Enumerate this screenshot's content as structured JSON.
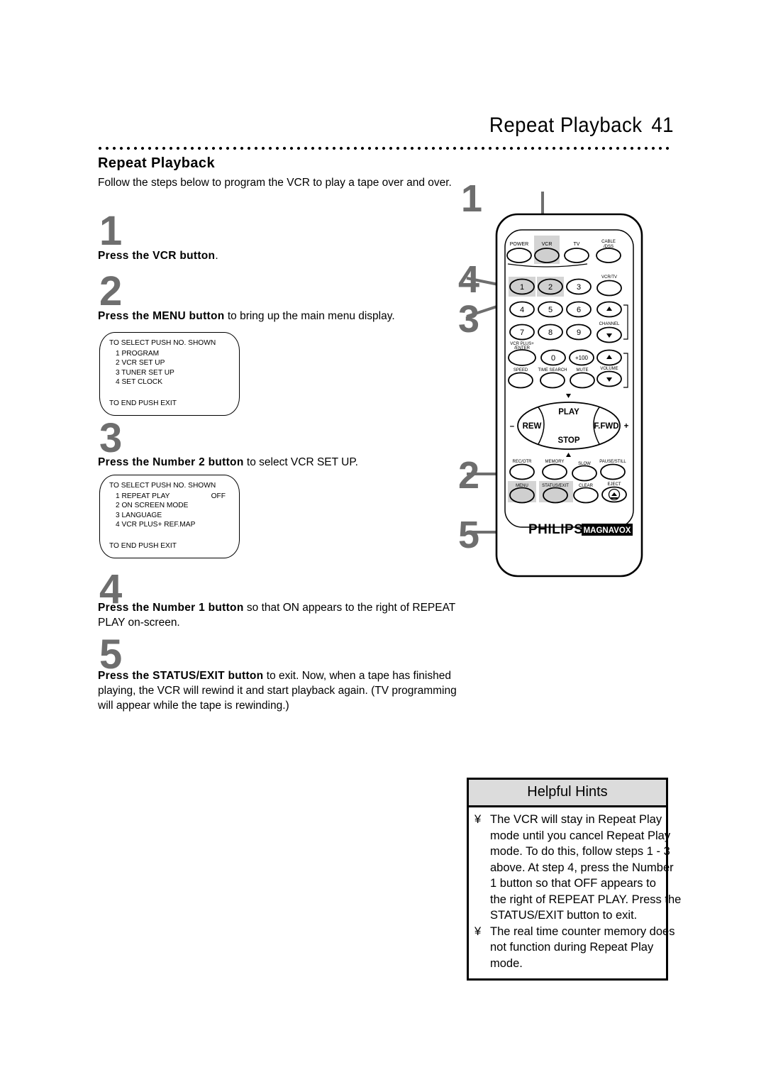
{
  "header": {
    "title": "Repeat Playback",
    "page_number": "41"
  },
  "section": {
    "title": "Repeat Playback",
    "intro": "Follow the steps below to program the VCR to play a tape over and over."
  },
  "steps": [
    {
      "number": "1",
      "bold": "Press the VCR button",
      "rest": "."
    },
    {
      "number": "2",
      "bold": "Press the MENU button",
      "rest": " to bring up the main menu display."
    },
    {
      "number": "3",
      "bold": "Press the Number 2 button",
      "rest": " to select VCR SET UP."
    },
    {
      "number": "4",
      "bold": "Press the Number 1 button",
      "rest": " so that ON appears to the right of REPEAT PLAY on-screen."
    },
    {
      "number": "5",
      "bold": "Press the STATUS/EXIT button",
      "rest": " to exit. Now, when a tape has finished playing, the VCR will rewind it and start playback again. (TV programming will appear while the tape is rewinding.)"
    }
  ],
  "osd_main_menu": {
    "head": "TO SELECT PUSH NO. SHOWN",
    "items": [
      {
        "label": "1 PROGRAM",
        "value": ""
      },
      {
        "label": "2 VCR SET UP",
        "value": ""
      },
      {
        "label": "3 TUNER SET UP",
        "value": ""
      },
      {
        "label": "4 SET CLOCK",
        "value": ""
      }
    ],
    "foot": "TO END PUSH EXIT"
  },
  "osd_vcr_setup": {
    "head": "TO SELECT PUSH NO. SHOWN",
    "items": [
      {
        "label": "1 REPEAT PLAY",
        "value": "OFF"
      },
      {
        "label": "2 ON SCREEN MODE",
        "value": ""
      },
      {
        "label": "3 LANGUAGE",
        "value": ""
      },
      {
        "label": "4 VCR PLUS+ REF.MAP",
        "value": ""
      }
    ],
    "foot": "TO END PUSH EXIT"
  },
  "remote": {
    "brand_primary": "PHILIPS",
    "brand_secondary": "MAGNAVOX",
    "callouts": [
      {
        "id": "1",
        "target": "VCR button"
      },
      {
        "id": "2",
        "target": "MENU button"
      },
      {
        "id": "3",
        "target": "Number 2 button"
      },
      {
        "id": "4",
        "target": "Number 1 button"
      },
      {
        "id": "5",
        "target": "STATUS/EXIT button"
      }
    ],
    "row_power": [
      "POWER",
      "VCR",
      "TV",
      "CABLE /DSS"
    ],
    "keypad": [
      "1",
      "2",
      "3",
      "4",
      "5",
      "6",
      "7",
      "8",
      "9",
      "0",
      "+100"
    ],
    "vcr_tv_label": "VCR/TV",
    "vcr_plus_label": "VCR PLUS+ /ENTER",
    "channel_label": "CHANNEL",
    "volume_label": "VOLUME",
    "row_speed": [
      "SPEED",
      "TIME SEARCH",
      "MUTE"
    ],
    "transport": [
      "PLAY",
      "REW",
      "F.FWD",
      "STOP"
    ],
    "transport_minus": "–",
    "transport_plus": "+",
    "row_rec": [
      "REC/OTR",
      "MEMORY",
      "SLOW",
      "PAUSE/STILL"
    ],
    "row_menu": [
      "MENU",
      "STATUS/EXIT",
      "CLEAR",
      "EJECT"
    ],
    "highlighted_buttons": [
      "VCR",
      "1",
      "2",
      "MENU",
      "STATUS/EXIT"
    ]
  },
  "hints": {
    "title": "Helpful Hints",
    "bullet": "¥",
    "items": [
      [
        "The VCR will stay in Repeat Play",
        "mode until you cancel Repeat Play",
        "mode. To do this, follow steps 1 - 3",
        "above. At step 4, press the Number",
        "1 button so that OFF appears to",
        "the right of REPEAT PLAY. Press the",
        "STATUS/EXIT button to exit."
      ],
      [
        "The real time counter memory does",
        "not function during Repeat Play",
        "mode."
      ]
    ]
  },
  "colors": {
    "step_number": "#6e6e6e",
    "hint_header_bg": "#dcdcdc",
    "button_highlight": "#d4d4d4",
    "ink": "#000000"
  }
}
